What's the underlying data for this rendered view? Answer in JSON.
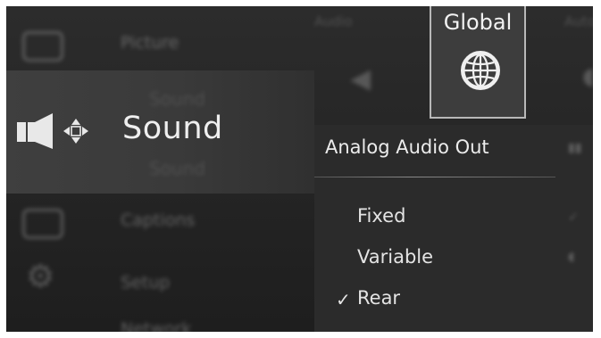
{
  "menu": {
    "items": [
      {
        "label": "Picture"
      },
      {
        "label": "Sound",
        "ghost_above": "Sound",
        "ghost_below": "Sound"
      },
      {
        "label": "Captions"
      },
      {
        "label": "Setup"
      },
      {
        "label": "Network"
      }
    ],
    "selected": "Sound"
  },
  "tabs": {
    "audio": "Audio",
    "global": "Global",
    "auto": "Auto"
  },
  "panel": {
    "title": "Analog Audio Out",
    "options": [
      {
        "label": "Fixed",
        "checked": false
      },
      {
        "label": "Variable",
        "checked": false
      },
      {
        "label": "Rear",
        "checked": true
      }
    ],
    "check_glyph": "✓"
  },
  "colors": {
    "background": "#242424",
    "selected_row": "#3c3c3c",
    "text": "#ececec",
    "tile_border": "#b8b8b8"
  }
}
